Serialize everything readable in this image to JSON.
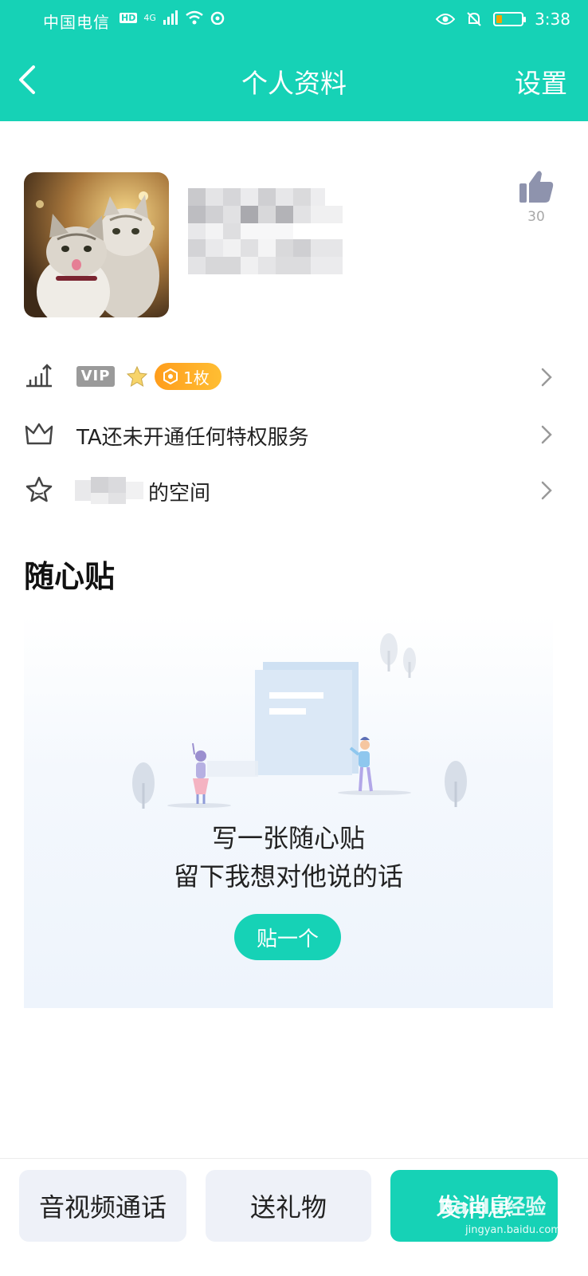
{
  "statusbar": {
    "carrier": "中国电信",
    "network": "4G",
    "hd": "HD",
    "time": "3:38"
  },
  "nav": {
    "title": "个人资料",
    "settings_label": "设置"
  },
  "profile": {
    "likes": "30"
  },
  "rows": {
    "vip_tag": "VIP",
    "coin_label": "1枚",
    "privilege_text": "TA还未开通任何特权服务",
    "space_suffix": "的空间"
  },
  "section": {
    "title": "随心贴"
  },
  "empty_state": {
    "line1": "写一张随心贴",
    "line2": "留下我想对他说的话",
    "button_label": "贴一个"
  },
  "bottom": {
    "call_label": "音视频通话",
    "gift_label": "送礼物",
    "message_label": "发消息",
    "watermark": "Baidu经验",
    "watermark_url": "jingyan.baidu.com"
  },
  "colors": {
    "accent": "#16d2b6",
    "coin": "#ffa51f"
  }
}
